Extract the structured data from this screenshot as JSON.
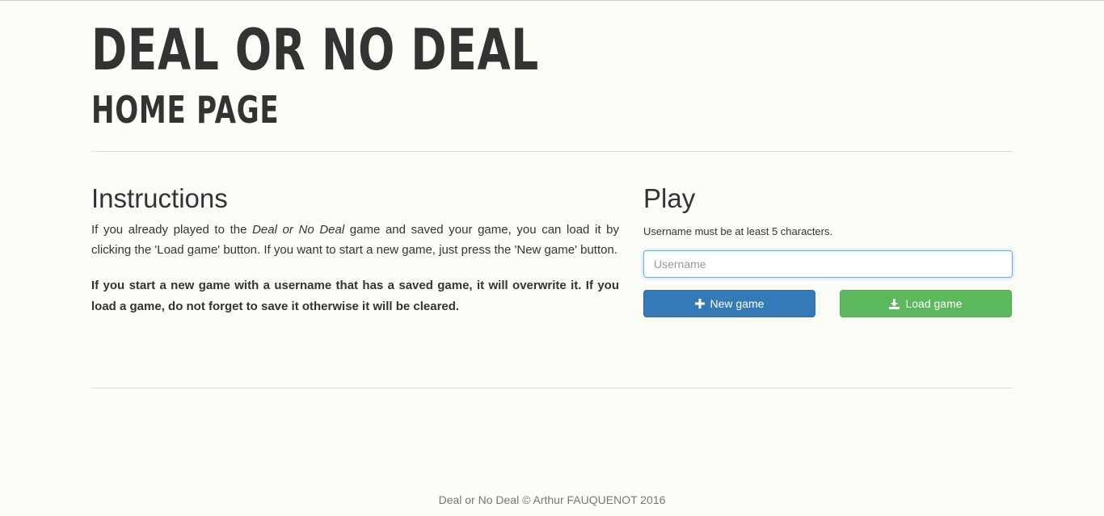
{
  "header": {
    "title": "DEAL OR NO DEAL",
    "subtitle": "HOME PAGE"
  },
  "instructions": {
    "heading": "Instructions",
    "para1_before": "If you already played to the ",
    "para1_emphasis": "Deal or No Deal",
    "para1_after": " game and saved your game, you can load it by clicking the 'Load game' button. If you want to start a new game, just press the 'New game' button.",
    "para2_bold": "If you start a new game with a username that has a saved game, it will overwrite it. If you load a game, do not forget to save it otherwise it will be cleared."
  },
  "play": {
    "heading": "Play",
    "hint": "Username must be at least 5 characters.",
    "username_placeholder": "Username",
    "username_value": "",
    "new_game_label": "New game",
    "load_game_label": "Load game",
    "new_game_icon": "plus-icon",
    "load_game_icon": "download-icon"
  },
  "footer": {
    "text": "Deal or No Deal © Arthur FAUQUENOT 2016"
  },
  "colors": {
    "background": "#fdfdf8",
    "primary_button": "#337ab7",
    "success_button": "#5cb85c",
    "input_focus_border": "#66afe9"
  }
}
